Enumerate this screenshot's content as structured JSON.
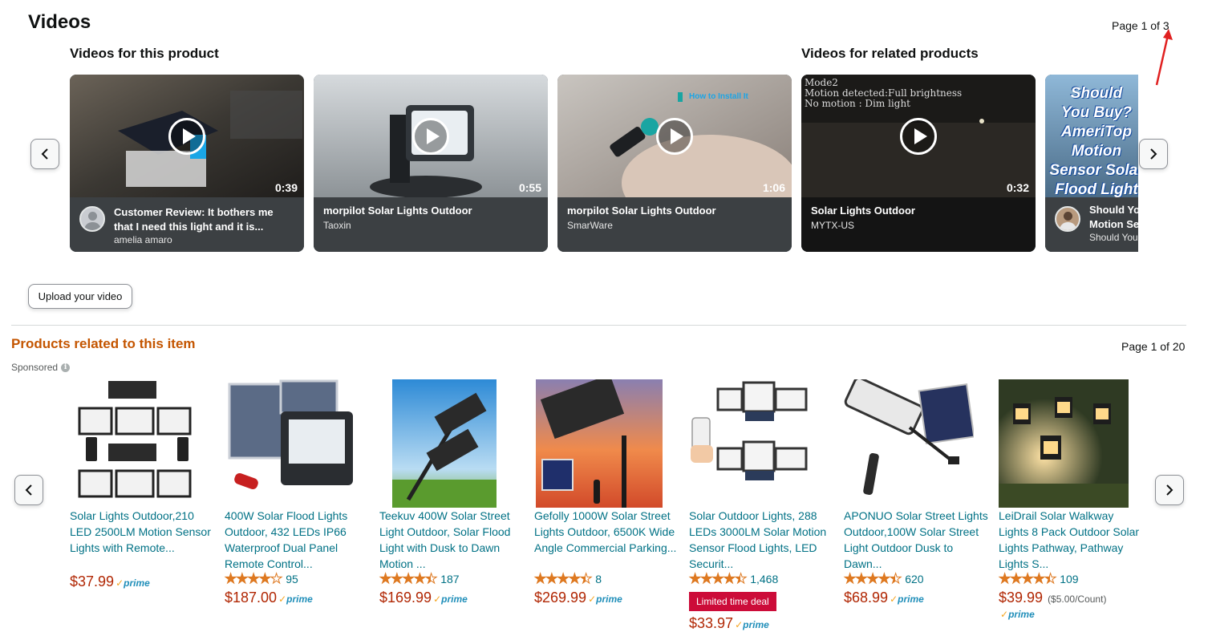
{
  "videos": {
    "title": "Videos",
    "page_indicator": "Page 1 of 3",
    "for_this_product": "Videos for this product",
    "for_related": "Videos for related products",
    "items": [
      {
        "title_line1": "Customer Review: It bothers me",
        "title_line2": "that I need this light and it is...",
        "author": "amelia amaro",
        "duration": "0:39"
      },
      {
        "title_line1": "morpilot Solar Lights Outdoor",
        "author": "Taoxin",
        "duration": "0:55"
      },
      {
        "title_line1": "morpilot Solar Lights Outdoor",
        "author": "SmarWare",
        "duration": "1:06",
        "overlay": "How to Install It"
      },
      {
        "title_line1": "Solar Lights Outdoor",
        "author": "MYTX-US",
        "duration": "0:32",
        "overlay_lines": [
          "Mode2",
          "Motion detected:Full brightness",
          "No motion : Dim light"
        ]
      },
      {
        "title_line1": "Should Yo",
        "title_line2": "Motion Se",
        "author": "Should You",
        "overlay_lines": [
          "Should",
          "You Buy?",
          "AmeriTop",
          "Motion",
          "Sensor Solar",
          "Flood Light"
        ]
      }
    ],
    "upload_label": "Upload your video"
  },
  "related": {
    "title": "Products related to this item",
    "page_indicator": "Page 1 of 20",
    "sponsored": "Sponsored",
    "info_icon": "i",
    "products": [
      {
        "title": "Solar Lights Outdoor,210 LED 2500LM Motion Sensor Lights with Remote...",
        "price": "$37.99",
        "rating": 0,
        "prime": "prime"
      },
      {
        "title": "400W Solar Flood Lights Outdoor, 432 LEDs IP66 Waterproof Dual Panel Remote Control...",
        "rating": 4.0,
        "count": "95",
        "price": "$187.00",
        "prime": "prime"
      },
      {
        "title": "Teekuv 400W Solar Street Light Outdoor, Solar Flood Light with Dusk to Dawn Motion ...",
        "rating": 4.5,
        "count": "187",
        "price": "$169.99",
        "prime": "prime"
      },
      {
        "title": "Gefolly 1000W Solar Street Lights Outdoor, 6500K Wide Angle Commercial Parking...",
        "rating": 4.5,
        "count": "8",
        "price": "$269.99",
        "prime": "prime"
      },
      {
        "title": "Solar Outdoor Lights, 288 LEDs 3000LM Solar Motion Sensor Flood Lights, LED Securit...",
        "rating": 4.5,
        "count": "1,468",
        "deal": "Limited time deal",
        "price": "$33.97",
        "prime": "prime"
      },
      {
        "title": "APONUO Solar Street Lights Outdoor,100W Solar Street Light Outdoor Dusk to Dawn...",
        "rating": 4.5,
        "count": "620",
        "price": "$68.99",
        "prime": "prime"
      },
      {
        "title": "LeiDrail Solar Walkway Lights 8 Pack Outdoor Solar Lights Pathway, Pathway Lights S...",
        "rating": 4.5,
        "count": "109",
        "price": "$39.99",
        "unit_price": "($5.00/Count)",
        "prime": "prime"
      }
    ]
  },
  "colors": {
    "link": "#007185",
    "price": "#b12704",
    "star": "#de7921",
    "heading_orange": "#c45500",
    "deal_red": "#cc0c39",
    "annotation_red": "#e02020"
  },
  "icons": {
    "prev": "chevron-left-icon",
    "next": "chevron-right-icon",
    "play": "play-icon",
    "annotation": "red-arrow-annotation"
  }
}
